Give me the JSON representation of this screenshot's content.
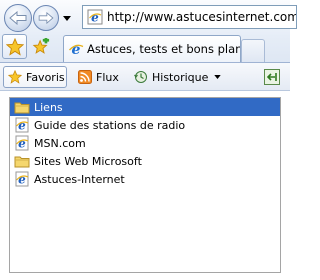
{
  "navigation": {
    "back_icon": "back-arrow-icon",
    "forward_icon": "forward-arrow-icon",
    "history_dropdown_icon": "chevron-down-icon"
  },
  "address_bar": {
    "url": "http://www.astucesinternet.com/",
    "page_icon": "ie-page-icon"
  },
  "tabs": {
    "favorites_center_icon": "favorites-star-icon",
    "add_favorite_icon": "add-favorite-star-icon",
    "active_tab_label": "Astuces, tests et bons plan...",
    "active_tab_icon": "ie-page-icon"
  },
  "favorites_panel": {
    "toolbar": {
      "favoris_label": "Favoris",
      "flux_label": "Flux",
      "historique_label": "Historique"
    },
    "pin_icon": "pin-panel-icon",
    "items": [
      {
        "label": "Liens",
        "icon": "folder-icon",
        "selected": true
      },
      {
        "label": "Guide des stations de radio",
        "icon": "ie-page-icon",
        "selected": false
      },
      {
        "label": "MSN.com",
        "icon": "ie-page-icon",
        "selected": false
      },
      {
        "label": "Sites Web Microsoft",
        "icon": "folder-icon",
        "selected": false
      },
      {
        "label": "Astuces-Internet",
        "icon": "ie-page-icon",
        "selected": false
      }
    ]
  },
  "colors": {
    "selection": "#316ac5",
    "toolbar_border": "#8fa7c8"
  }
}
